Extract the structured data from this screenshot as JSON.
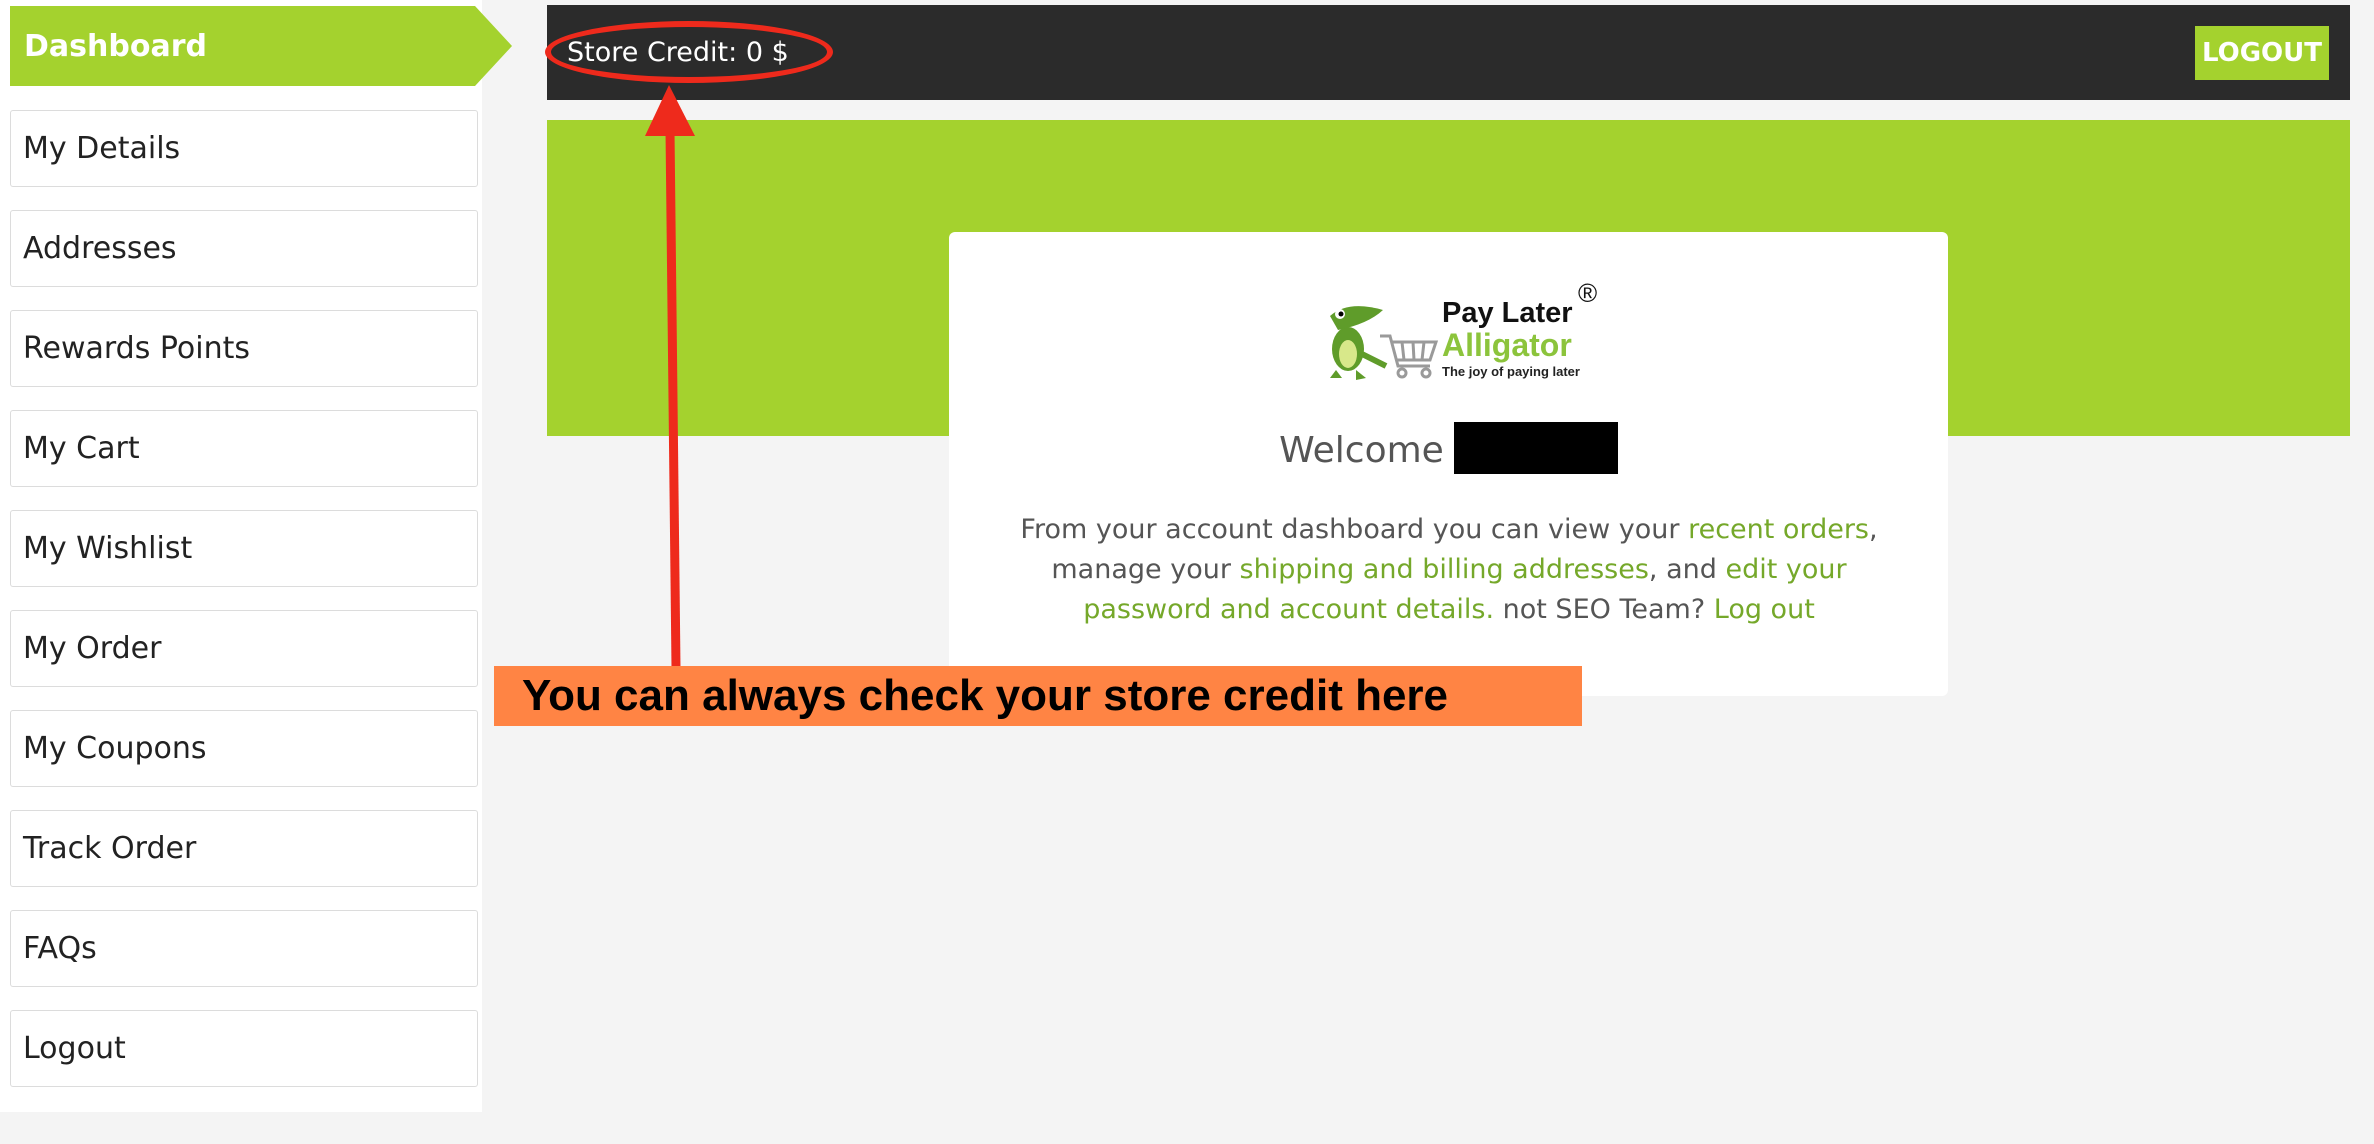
{
  "sidebar": {
    "active": "Dashboard",
    "items": [
      "My Details",
      "Addresses",
      "Rewards Points",
      "My Cart",
      "My Wishlist",
      "My Order",
      "My Coupons",
      "Track Order",
      "FAQs",
      "Logout"
    ]
  },
  "header": {
    "store_credit": "Store Credit: 0 $",
    "logout_label": "LOGOUT"
  },
  "logo": {
    "line1": "Pay Later",
    "line2": "Alligator",
    "tagline": "The joy of paying later",
    "mark": "®"
  },
  "card": {
    "welcome": "Welcome",
    "desc_1": "From your account dashboard you can view your ",
    "link_orders": "recent orders",
    "desc_2": ", manage your ",
    "link_addresses": "shipping and billing addresses",
    "desc_3": ", and ",
    "link_account": "edit your password and account details.",
    "desc_4": " not SEO Team? ",
    "link_logout": "Log out"
  },
  "annotation": {
    "callout": "You can always check your store credit here"
  },
  "colors": {
    "accent": "#a4d22e",
    "link": "#75a82a",
    "topbar": "#2b2b2b",
    "annotation_red": "#ee2a1c",
    "callout_bg": "#ff8444"
  },
  "icons": [
    "alligator-mascot-icon",
    "shopping-cart-icon"
  ]
}
